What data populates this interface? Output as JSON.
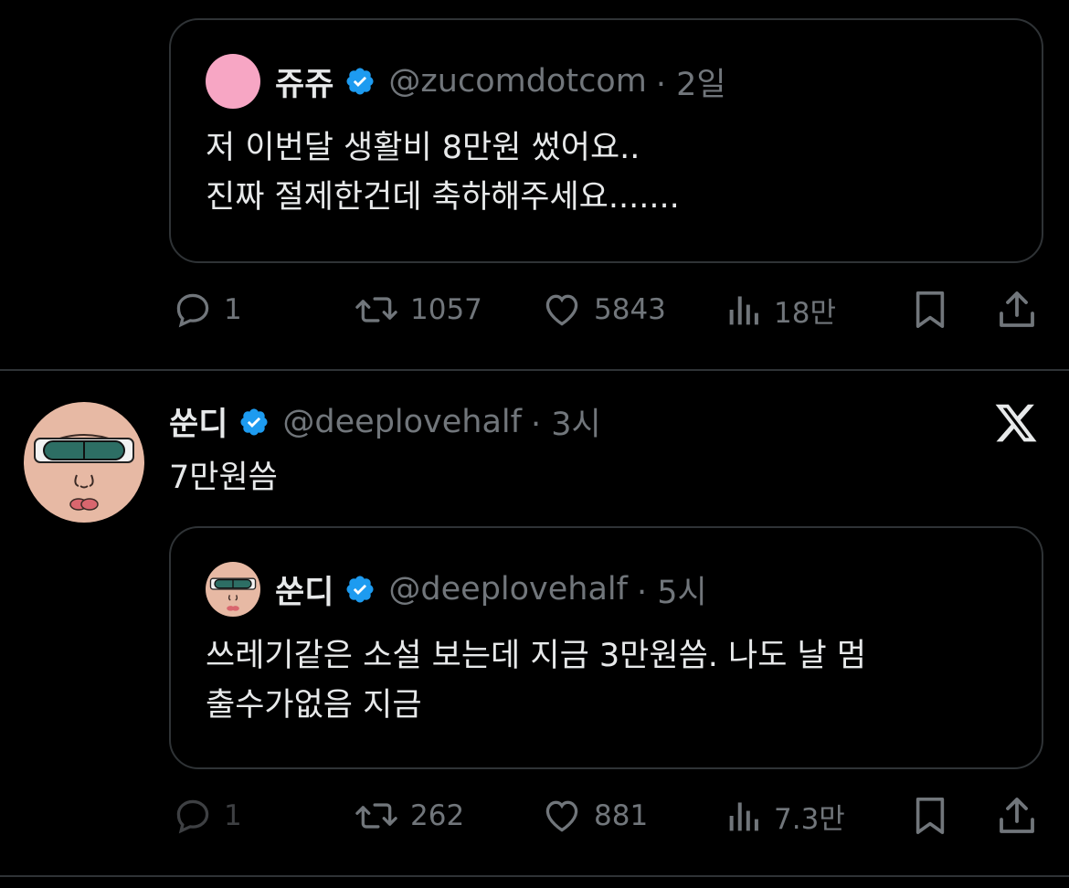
{
  "quoted_tweet_1": {
    "display_name": "쥬쥬",
    "handle": "@zucomdotcom",
    "time": "· 2일",
    "avatar_color": "#f7a6c4",
    "text_lines": [
      "저 이번달 생활비 8만원 썼어요..",
      "진짜 절제한건데 축하해주세요......."
    ]
  },
  "actions_1": {
    "reply_count": "1",
    "retweet_count": "1057",
    "like_count": "5843",
    "views_count": "18만"
  },
  "tweet": {
    "display_name": "쑨디",
    "handle": "@deeplovehalf",
    "time": "· 3시",
    "text": "7만원씀",
    "platform_icon": "x-logo-icon"
  },
  "quoted_tweet_2": {
    "display_name": "쑨디",
    "handle": "@deeplovehalf",
    "time": "· 5시",
    "text_lines": [
      "쓰레기같은 소설 보는데 지금 3만원씀. 나도 날 멈",
      "출수가없음 지금"
    ]
  },
  "actions_2": {
    "reply_count": "1",
    "retweet_count": "262",
    "like_count": "881",
    "views_count": "7.3만"
  },
  "colors": {
    "background": "#000000",
    "text_primary": "#e7e9ea",
    "text_secondary": "#71767b",
    "border": "#2f3336",
    "verified_blue": "#1d9bf0"
  }
}
